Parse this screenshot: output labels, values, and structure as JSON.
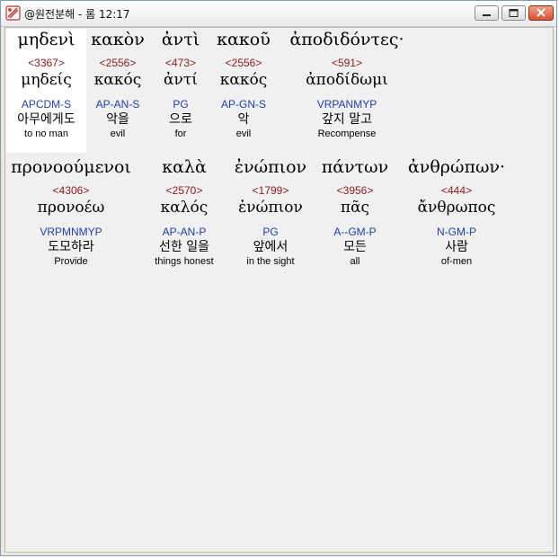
{
  "window": {
    "title": "@원전분해 - 롬 12:17",
    "buttons": {
      "minimize": "minimize",
      "maximize": "maximize",
      "close": "close"
    }
  },
  "row1": [
    {
      "greek": "μηδενὶ",
      "strong": "<3367>",
      "lemma": "μηδείς",
      "morph": "APCDM-S",
      "korean": "아무에게도",
      "english": "to no man"
    },
    {
      "greek": "κακὸν",
      "strong": "<2556>",
      "lemma": "κακός",
      "morph": "AP-AN-S",
      "korean": "악을",
      "english": "evil"
    },
    {
      "greek": "ἀντὶ",
      "strong": "<473>",
      "lemma": "ἀντί",
      "morph": "PG",
      "korean": "으로",
      "english": "for"
    },
    {
      "greek": "κακοῦ",
      "strong": "<2556>",
      "lemma": "κακός",
      "morph": "AP-GN-S",
      "korean": "악",
      "english": "evil"
    },
    {
      "greek": "ἀποδιδόντες·",
      "strong": "<591>",
      "lemma": "ἀποδίδωμι",
      "morph": "VRPANMYP",
      "korean": "갚지 말고",
      "english": "Recompense"
    }
  ],
  "row2": [
    {
      "greek": "προνοούμενοι",
      "strong": "<4306>",
      "lemma": "προνοέω",
      "morph": "VRPMNMYP",
      "korean": "도모하라",
      "english": "Provide"
    },
    {
      "greek": "καλὰ",
      "strong": "<2570>",
      "lemma": "καλός",
      "morph": "AP-AN-P",
      "korean": "선한 일을",
      "english": "things honest"
    },
    {
      "greek": "ἐνώπιον",
      "strong": "<1799>",
      "lemma": "ἐνώπιον",
      "morph": "PG",
      "korean": "앞에서",
      "english": "in the sight"
    },
    {
      "greek": "πάντων",
      "strong": "<3956>",
      "lemma": "πᾶς",
      "morph": "A--GM-P",
      "korean": "모든",
      "english": "all"
    },
    {
      "greek": "ἀνθρώπων·",
      "strong": "<444>",
      "lemma": "ἄνθρωπος",
      "morph": "N-GM-P",
      "korean": "사람",
      "english": "of-men"
    }
  ]
}
